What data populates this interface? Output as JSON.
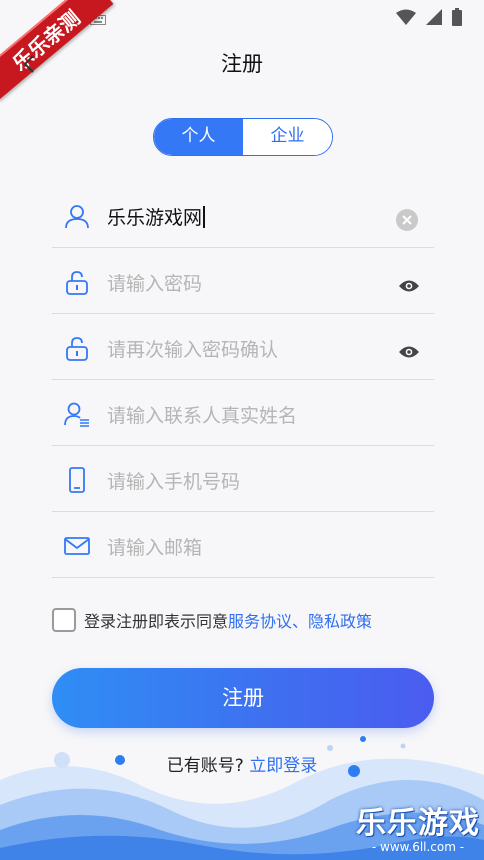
{
  "header": {
    "title": "注册",
    "ribbon_text": "乐乐亲测"
  },
  "tabs": {
    "personal": "个人",
    "enterprise": "企业"
  },
  "fields": {
    "username": {
      "value": "乐乐游戏网"
    },
    "password": {
      "placeholder": "请输入密码"
    },
    "confirm_password": {
      "placeholder": "请再次输入密码确认"
    },
    "contact_name": {
      "placeholder": "请输入联系人真实姓名"
    },
    "phone": {
      "placeholder": "请输入手机号码"
    },
    "email": {
      "placeholder": "请输入邮箱"
    }
  },
  "agreement": {
    "prefix": "登录注册即表示同意",
    "service_link": "服务协议",
    "separator": "、",
    "privacy_link": "隐私政策"
  },
  "submit_label": "注册",
  "login_prompt": {
    "text": "已有账号?",
    "link": "立即登录"
  },
  "watermark": {
    "main": "乐乐游戏",
    "sub": "- www.6ll.com -"
  },
  "colors": {
    "accent": "#3478f6",
    "link": "#2f6ff0",
    "ribbon": "#c8181f"
  }
}
